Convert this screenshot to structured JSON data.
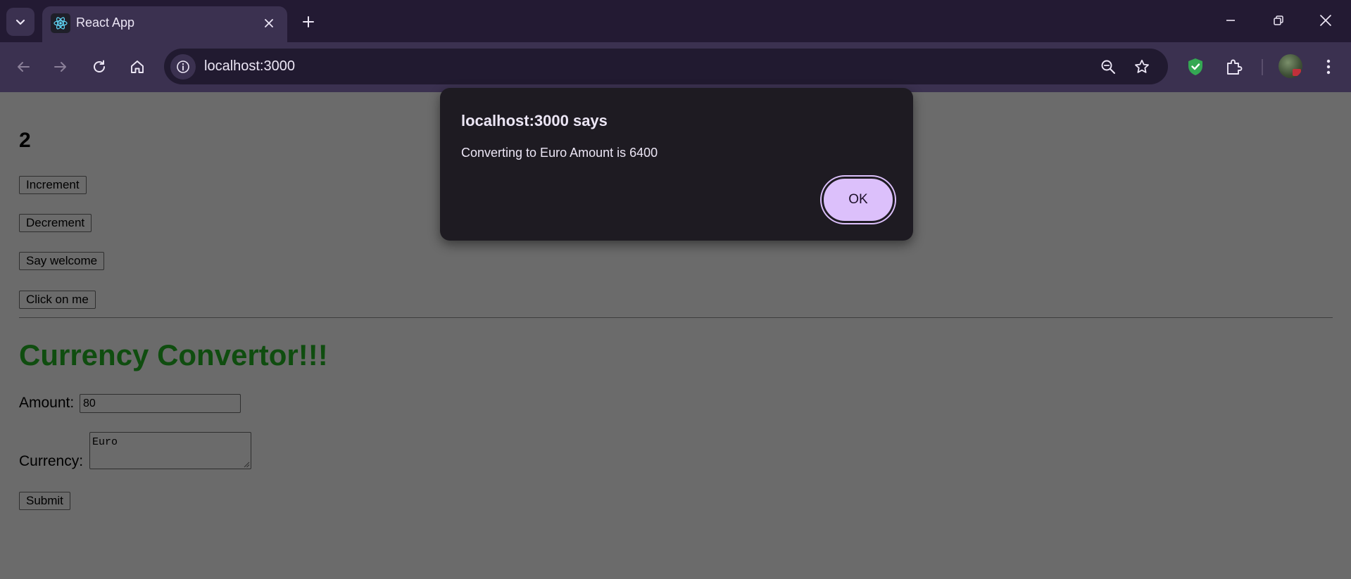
{
  "browser": {
    "tab": {
      "title": "React App",
      "favicon": "react-logo-icon"
    },
    "address_bar": {
      "url": "localhost:3000"
    },
    "icons": {
      "tab_search": "chevron-down-icon",
      "close_tab": "close-icon",
      "new_tab": "plus-icon",
      "minimize": "minimize-icon",
      "restore": "restore-icon",
      "close_window": "close-icon",
      "back": "arrow-left-icon",
      "forward": "arrow-right-icon",
      "reload": "reload-icon",
      "home": "home-icon",
      "site_info": "info-icon",
      "zoom": "zoom-out-icon",
      "bookmark": "star-icon",
      "shield_extension": "shield-check-icon",
      "extensions": "puzzle-icon",
      "menu": "kebab-menu-icon"
    },
    "colors": {
      "frame": "#231a33",
      "toolbar": "#3b3150",
      "omnibox": "#211a30"
    }
  },
  "page": {
    "counter": "2",
    "buttons": {
      "increment": "Increment",
      "decrement": "Decrement",
      "say_welcome": "Say welcome",
      "click_on_me": "Click on me"
    },
    "converter": {
      "title": "Currency Convertor!!!",
      "amount_label": "Amount:",
      "amount_value": "80",
      "currency_label": "Currency:",
      "currency_value": "Euro",
      "submit": "Submit"
    },
    "colors": {
      "title": "#0f4d0f",
      "overlay_background": "#6b6b6b"
    }
  },
  "dialog": {
    "title": "localhost:3000 says",
    "message": "Converting to Euro Amount is 6400",
    "ok": "OK",
    "colors": {
      "background": "#1e1b22",
      "button": "#dcc0fb"
    }
  }
}
